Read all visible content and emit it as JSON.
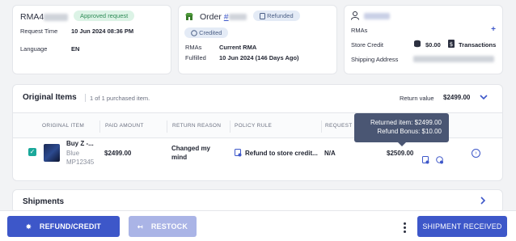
{
  "rma_card": {
    "title_prefix": "RMA4",
    "status": "Approved request",
    "rows": [
      {
        "label": "Request Time",
        "value": "10 Jun 2024 08:36 PM"
      },
      {
        "label": "Language",
        "value": "EN"
      }
    ]
  },
  "order_card": {
    "title": "Order",
    "order_prefix": "#",
    "badges": {
      "refunded": "Refunded",
      "credited": "Credited"
    },
    "rows": [
      {
        "label": "RMAs",
        "value": "Current RMA"
      },
      {
        "label": "Fulfilled",
        "value": "10 Jun 2024 (146 Days Ago)"
      }
    ]
  },
  "customer_card": {
    "rows": [
      {
        "label": "RMAs",
        "value": "+"
      },
      {
        "label": "Store Credit",
        "value": "$0.00",
        "link": "Transactions"
      },
      {
        "label": "Shipping Address",
        "value": ""
      }
    ]
  },
  "items": {
    "title": "Original Items",
    "subtitle": "1 of 1 purchased item.",
    "return_value_label": "Return value",
    "return_value": "$2499.00",
    "columns": [
      "ORIGINAL ITEM",
      "PAID AMOUNT",
      "RETURN REASON",
      "POLICY RULE",
      "REQUEST D"
    ],
    "row": {
      "name": "Buy Z -...",
      "variant": "Blue",
      "sku": "MP12345",
      "paid": "$2499.00",
      "reason_line1": "Changed my",
      "reason_line2": "mind",
      "policy": "Refund to store credit...",
      "request": "N/A",
      "total": "$2509.00"
    },
    "tooltip": {
      "line1": "Returned item: $2499.00",
      "line2": "Refund Bonus: $10.00"
    }
  },
  "shipments": {
    "title": "Shipments"
  },
  "footer": {
    "refund_label": "REFUND/CREDIT",
    "restock_label": "RESTOCK",
    "shipment_label": "SHIPMENT RECEIVED"
  },
  "colors": {
    "accent": "#3d57c9",
    "success": "#1aa89a",
    "approved_bg": "#dcf3e6"
  }
}
